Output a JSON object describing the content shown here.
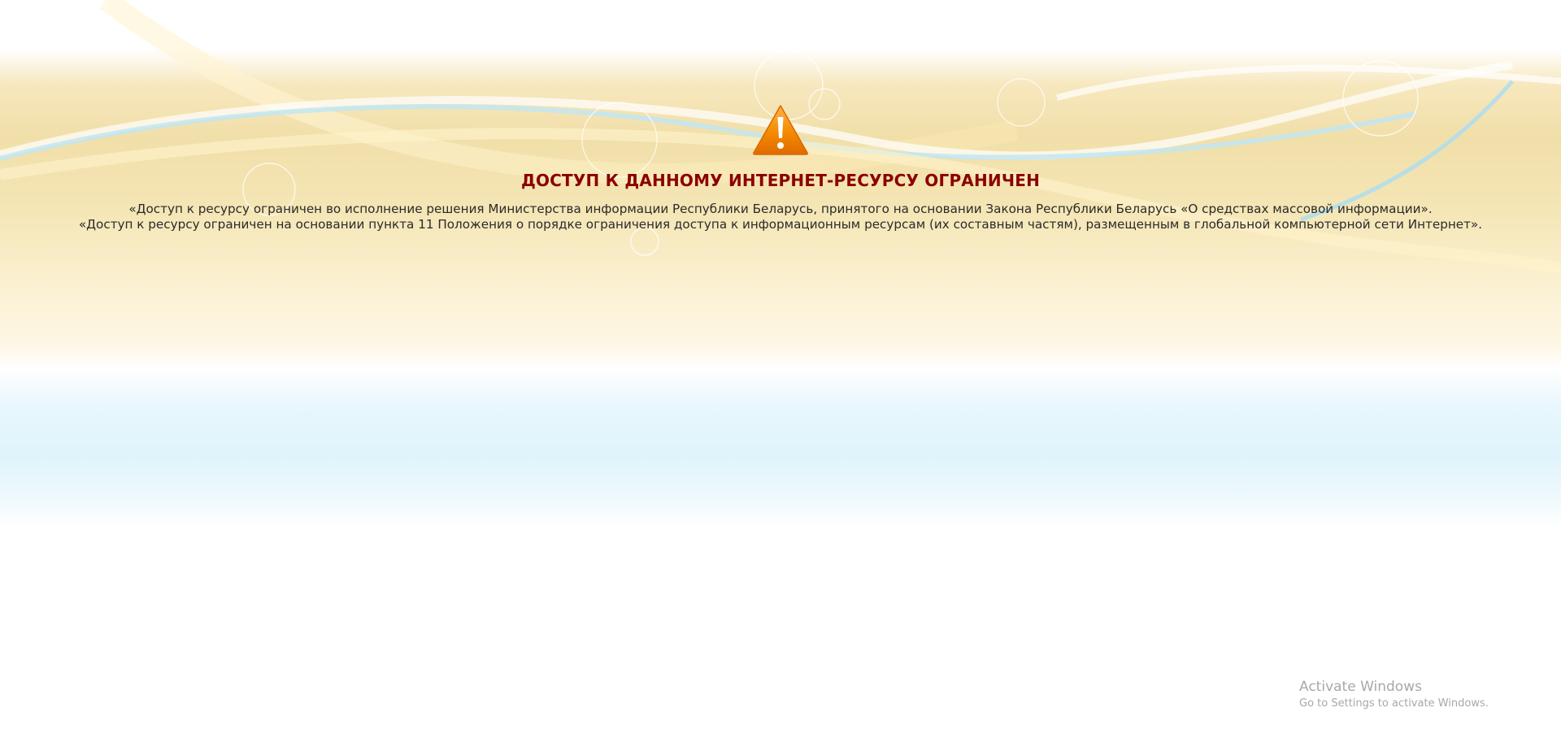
{
  "notice": {
    "icon": "warning-triangle-icon",
    "title": "ДОСТУП К ДАННОМУ ИНТЕРНЕТ-РЕСУРСУ ОГРАНИЧЕН",
    "lines": [
      "«Доступ к ресурсу ограничен во исполнение решения Министерства информации Республики Беларусь, принятого на основании Закона Республики Беларусь «О средствах массовой информации».",
      "«Доступ к ресурсу ограничен на основании пункта 11 Положения о порядке ограничения доступа к информационным ресурсам (их составным частям), размещенным в глобальной компьютерной сети Интернет»."
    ]
  },
  "windows_watermark": {
    "title": "Activate Windows",
    "subtitle": "Go to Settings to activate Windows."
  },
  "colors": {
    "title": "#8b0000",
    "text": "#2a2a2a",
    "icon_orange": "#f58a00",
    "background_gold": "#f1dfa9",
    "background_blue": "#dff4fc"
  }
}
